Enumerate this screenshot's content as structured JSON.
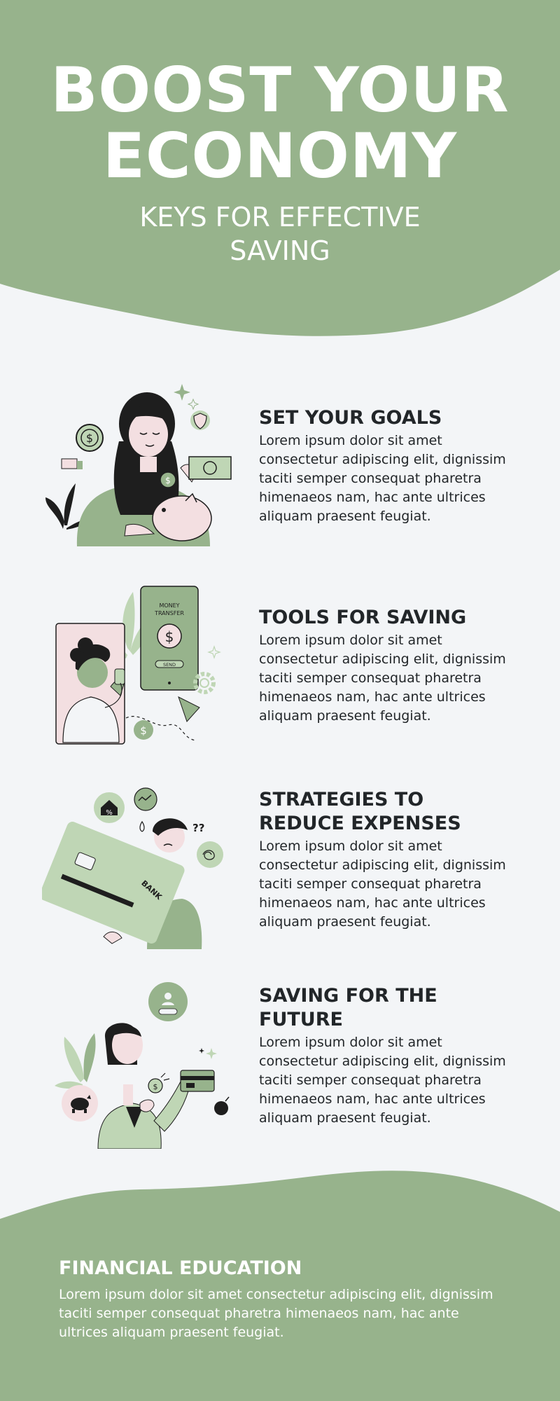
{
  "hero": {
    "title_line1": "BOOST YOUR",
    "title_line2": "ECONOMY",
    "subtitle_line1": "KEYS FOR EFFECTIVE",
    "subtitle_line2": "SAVING"
  },
  "sections": [
    {
      "title": "SET YOUR GOALS",
      "body": "Lorem ipsum dolor sit amet consectetur adipiscing elit, dignissim taciti semper consequat pharetra himenaeos nam, hac ante ultrices aliquam praesent feugiat."
    },
    {
      "title": "TOOLS FOR SAVING",
      "body": "Lorem ipsum dolor sit amet consectetur adipiscing elit, dignissim taciti semper consequat pharetra himenaeos nam, hac ante ultrices aliquam praesent feugiat.",
      "phone_line1": "MONEY",
      "phone_line2": "TRANSFER",
      "phone_button": "SEND"
    },
    {
      "title_line1": "STRATEGIES TO",
      "title_line2": "REDUCE EXPENSES",
      "body": "Lorem ipsum dolor sit amet consectetur adipiscing elit, dignissim taciti semper consequat pharetra himenaeos nam, hac ante ultrices aliquam praesent feugiat.",
      "card_label": "BANK",
      "question_marks": "??"
    },
    {
      "title_line1": "SAVING FOR THE",
      "title_line2": "FUTURE",
      "body": "Lorem ipsum dolor sit amet consectetur adipiscing elit, dignissim taciti semper consequat pharetra himenaeos nam, hac ante ultrices aliquam praesent feugiat."
    }
  ],
  "footer": {
    "title": "FINANCIAL EDUCATION",
    "body": "Lorem ipsum dolor sit amet consectetur adipiscing elit, dignissim taciti semper consequat pharetra himenaeos nam, hac ante ultrices aliquam praesent feugiat."
  },
  "colors": {
    "accent_green": "#97b38c",
    "light_green": "#bfd6b5",
    "pale_pink": "#f3dfe1",
    "dark_text": "#222629",
    "background": "#f3f5f7",
    "white": "#ffffff"
  },
  "icons": [
    "dollar-coin-icon",
    "shield-icon",
    "sparkle-icon",
    "banknote-icon",
    "piggy-bank-icon",
    "plant-icon",
    "gear-icon",
    "paper-plane-icon",
    "house-percent-icon",
    "chart-icon",
    "scribble-bubble-icon",
    "credit-card-icon",
    "user-profile-icon",
    "bomb-icon"
  ]
}
